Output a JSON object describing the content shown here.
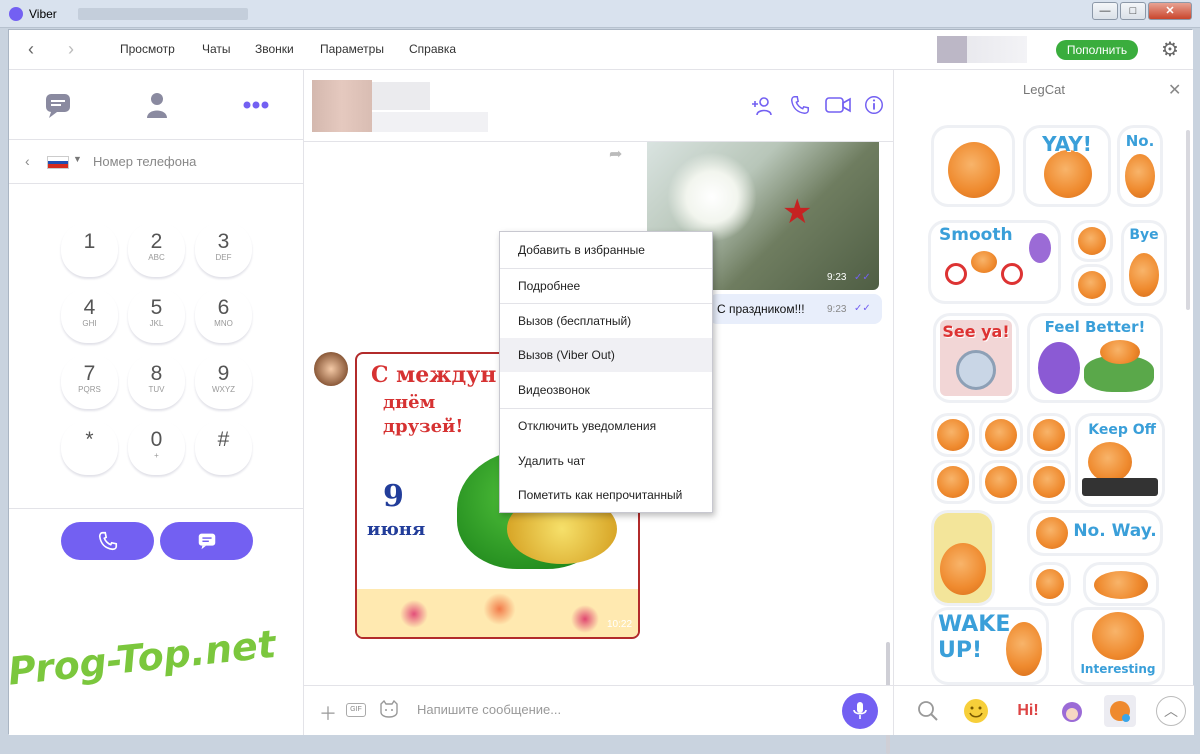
{
  "window": {
    "title": "Viber",
    "minimize": "—",
    "maximize": "□",
    "close": "✕"
  },
  "menu": {
    "items": [
      "Просмотр",
      "Чаты",
      "Звонки",
      "Параметры",
      "Справка"
    ],
    "topup_label": "Пополнить",
    "back_icon": "chevron-left-icon",
    "forward_icon": "chevron-right-icon",
    "settings_icon": "gear-icon"
  },
  "left_panel": {
    "tabs": [
      {
        "icon": "chat-icon",
        "active": false
      },
      {
        "icon": "contacts-icon",
        "active": false
      },
      {
        "icon": "more-icon",
        "active": true
      }
    ],
    "phone_placeholder": "Номер телефона",
    "keypad": [
      {
        "num": "1",
        "sub": ""
      },
      {
        "num": "2",
        "sub": "ABC"
      },
      {
        "num": "3",
        "sub": "DEF"
      },
      {
        "num": "4",
        "sub": "GHI"
      },
      {
        "num": "5",
        "sub": "JKL"
      },
      {
        "num": "6",
        "sub": "MNO"
      },
      {
        "num": "7",
        "sub": "PQRS"
      },
      {
        "num": "8",
        "sub": "TUV"
      },
      {
        "num": "9",
        "sub": "WXYZ"
      },
      {
        "num": "*",
        "sub": ""
      },
      {
        "num": "0",
        "sub": "+"
      },
      {
        "num": "#",
        "sub": ""
      }
    ]
  },
  "chat": {
    "messages": {
      "photo_time": "9:23",
      "text": "С праздником!!!",
      "text_time": "9:23",
      "card_line1": "С междун",
      "card_line2": "днём",
      "card_line3": "друзей!",
      "card_day": "9",
      "card_month": "июня",
      "card_time": "10:22"
    },
    "composer_placeholder": "Напишите сообщение...",
    "gif_label": "GIF"
  },
  "context_menu": {
    "items": [
      "Добавить в избранные",
      "Подробнее",
      "Вызов (бесплатный)",
      "Вызов (Viber Out)",
      "Видеозвонок",
      "Отключить уведомления",
      "Удалить чат",
      "Пометить как непрочитанный"
    ],
    "hovered_index": 3
  },
  "sticker_panel": {
    "title": "LegCat",
    "stickers": [
      "YAY!",
      "No.",
      "Smooth",
      "Bye",
      "See ya!",
      "Feel Better!",
      "Keep Off",
      "No. Way.",
      "WAKE UP!",
      "Interesting"
    ],
    "bottom_icons": [
      "search-icon",
      "smiley-icon",
      "hi-sticker-icon",
      "purple-character-icon",
      "legcat-icon",
      "chevron-up-icon"
    ]
  },
  "watermark": "Prog-Top.net",
  "colors": {
    "accent": "#7360f2",
    "topup": "#3aad3d"
  }
}
